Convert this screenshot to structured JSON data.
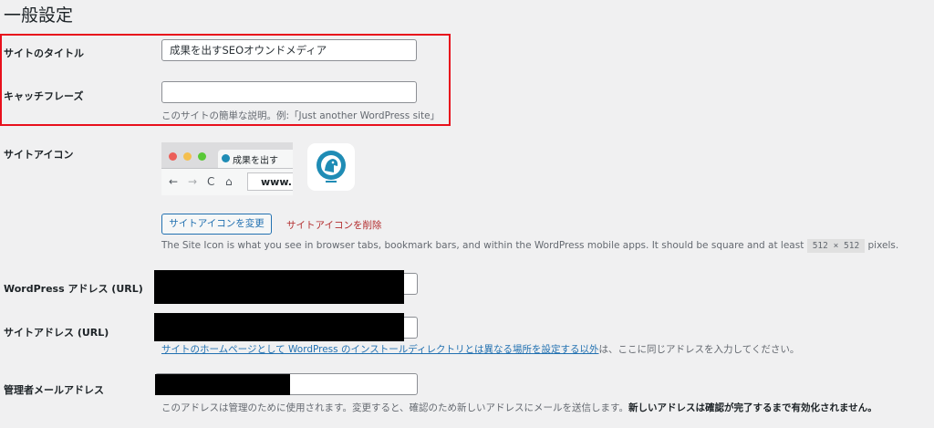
{
  "page": {
    "title": "一般設定"
  },
  "site_title": {
    "label": "サイトのタイトル",
    "value": "成果を出すSEOオウンドメディア"
  },
  "tagline": {
    "label": "キャッチフレーズ",
    "value": "",
    "description": "このサイトの簡単な説明。例:「Just another WordPress site」"
  },
  "site_icon": {
    "label": "サイトアイコン",
    "preview_tab_text": "成果を出す",
    "preview_url_text": "www.",
    "change_button": "サイトアイコンを変更",
    "remove_link": "サイトアイコンを削除",
    "description_before": "The Site Icon is what you see in browser tabs, bookmark bars, and within the WordPress mobile apps. It should be square and at least",
    "size_code": "512 × 512",
    "description_after": "pixels."
  },
  "wp_address": {
    "label": "WordPress アドレス (URL)"
  },
  "site_address": {
    "label": "サイトアドレス (URL)",
    "help_link": "サイトのホームページとして WordPress のインストールディレクトリとは異なる場所を設定する以外",
    "help_rest": "は、ここに同じアドレスを入力してください。"
  },
  "admin_email": {
    "label": "管理者メールアドレス",
    "description": "このアドレスは管理のために使用されます。変更すると、確認のため新しいアドレスにメールを送信します。",
    "description_bold": "新しいアドレスは確認が完了するまで有効化されません。"
  },
  "colors": {
    "highlight": "#e8101c",
    "link": "#2271b1",
    "danger": "#b32d2e",
    "brand_icon": "#1f8cb5"
  }
}
